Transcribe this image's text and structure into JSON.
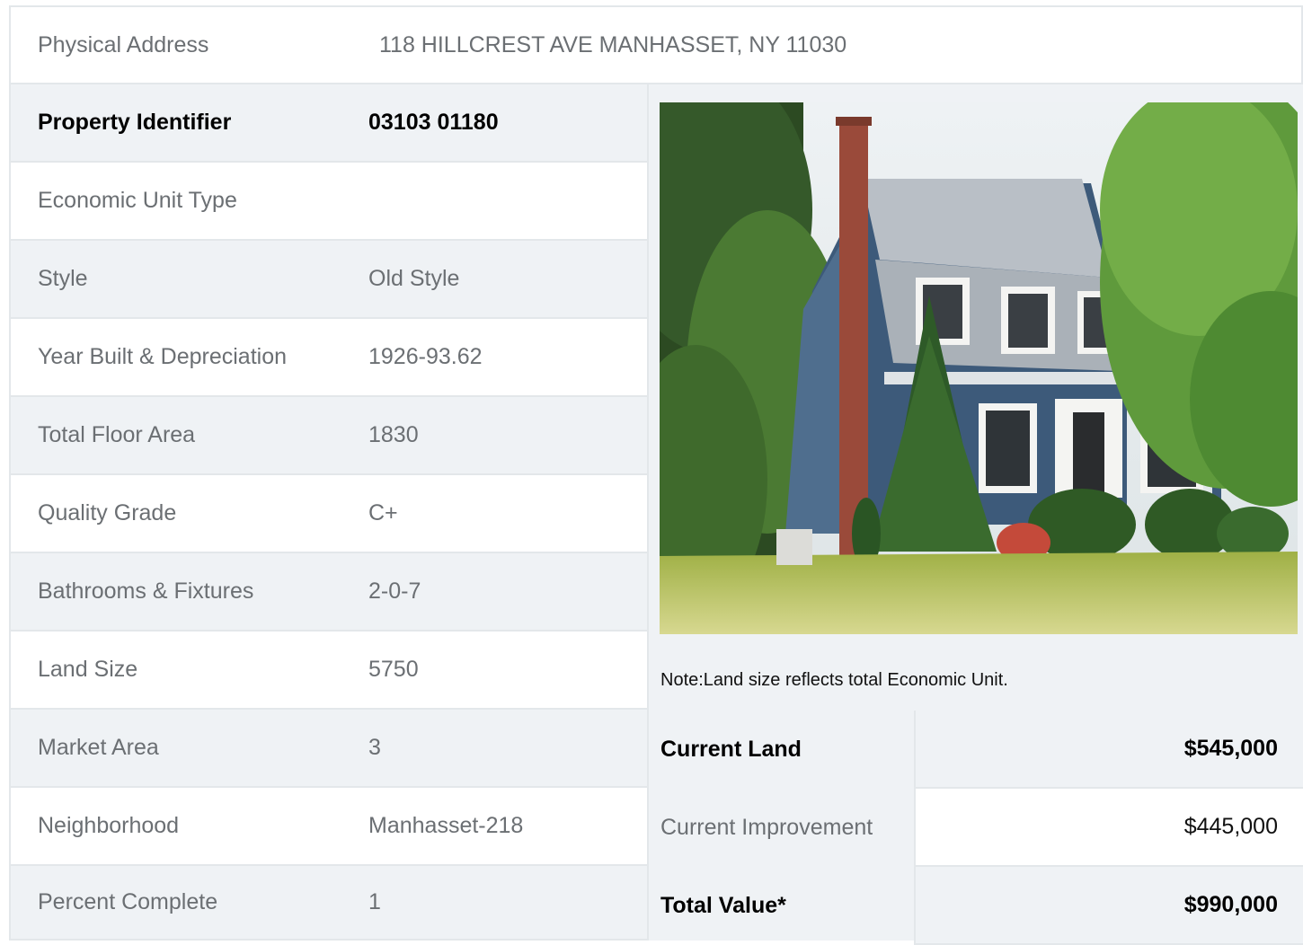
{
  "address": {
    "label": "Physical Address",
    "value": "118  HILLCREST AVE  MANHASSET, NY  11030"
  },
  "details": [
    {
      "label": "Property Identifier",
      "value": "03103  01180"
    },
    {
      "label": "Economic Unit Type",
      "value": ""
    },
    {
      "label": "Style",
      "value": "Old Style"
    },
    {
      "label": "Year Built & Depreciation",
      "value": "1926-93.62"
    },
    {
      "label": "Total Floor Area",
      "value": "1830"
    },
    {
      "label": "Quality Grade",
      "value": "C+"
    },
    {
      "label": "Bathrooms & Fixtures",
      "value": "2-0-7"
    },
    {
      "label": "Land Size",
      "value": "5750"
    },
    {
      "label": "Market Area",
      "value": "3"
    },
    {
      "label": "Neighborhood",
      "value": "Manhasset-218"
    },
    {
      "label": "Percent Complete",
      "value": "1"
    }
  ],
  "note": "Note:Land size reflects total Economic Unit.",
  "valuation": [
    {
      "label": "Current Land",
      "value": "$545,000"
    },
    {
      "label": "Current Improvement",
      "value": "$445,000"
    },
    {
      "label": "Total Value*",
      "value": "$990,000"
    }
  ],
  "colors": {
    "row_gray": "#eff2f5",
    "border": "#e3e7ea",
    "house_siding": "#3d5a7a",
    "lawn": "#b9c766"
  }
}
